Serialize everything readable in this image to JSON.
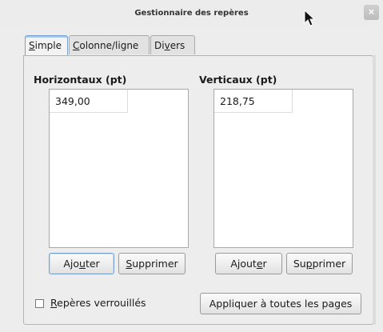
{
  "window": {
    "title": "Gestionnaire des repères",
    "close_glyph": "×"
  },
  "tabs": [
    {
      "pre": "",
      "u": "S",
      "post": "imple"
    },
    {
      "pre": "",
      "u": "C",
      "post": "olonne/ligne"
    },
    {
      "pre": "Di",
      "u": "v",
      "post": "ers"
    }
  ],
  "horizontal": {
    "title": "Horizontaux (pt)",
    "values": [
      "349,00"
    ],
    "add": {
      "pre": "Ajo",
      "u": "u",
      "post": "ter"
    },
    "remove": {
      "pre": "",
      "u": "S",
      "post": "upprimer"
    }
  },
  "vertical": {
    "title": "Verticaux (pt)",
    "values": [
      "218,75"
    ],
    "add": {
      "pre": "Ajout",
      "u": "e",
      "post": "r"
    },
    "remove": {
      "pre": "Su",
      "u": "p",
      "post": "primer"
    }
  },
  "locked": {
    "pre": "",
    "u": "R",
    "post": "epères verrouillés",
    "checked": false
  },
  "apply_all": "Appliquer à toutes les pages"
}
